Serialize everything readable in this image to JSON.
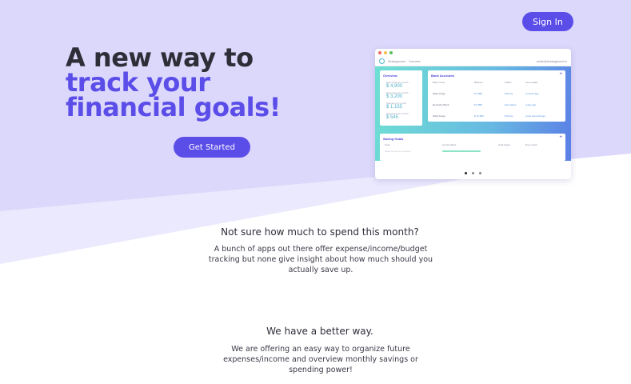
{
  "header": {
    "signin_label": "Sign In"
  },
  "hero": {
    "headline_line1": "A new way to",
    "headline_line2": "track your financial goals!",
    "cta_label": "Get Started"
  },
  "preview": {
    "nav_items": [
      "Strategyboard",
      "Overview"
    ],
    "nav_right": "admin@strategyboard.io",
    "overview": {
      "title": "Overview",
      "items": [
        {
          "label": "Expenses per month",
          "value": "$ 4,900"
        },
        {
          "label": "Expenses per month",
          "value": "$ 3,200"
        },
        {
          "label": "Savings per month",
          "value": "$ 1,155"
        },
        {
          "label": "Expenses per month",
          "value": "$ 545"
        }
      ]
    },
    "bank": {
      "title": "Bank Accounts",
      "plus": "+",
      "headers": [
        "Bank name",
        "Balance",
        "Status",
        "Last update"
      ],
      "rows": [
        [
          "Wells Fargo",
          "$ 4,850",
          "Primary",
          "a month ago"
        ],
        [
          "Deutsche Bank",
          "$ 4,850",
          "Secondary",
          "a day ago"
        ],
        [
          "Wells Fargo",
          "$ 12,980",
          "Primary",
          "a few seconds ago"
        ]
      ]
    },
    "saving": {
      "title": "Saving Goals",
      "plus": "+",
      "headers": [
        "Goal",
        "Accumulated",
        "Goal target",
        "Due month"
      ],
      "row": [
        "Save money for a house",
        "",
        "",
        ""
      ]
    }
  },
  "section1": {
    "title": "Not sure how much to spend this month?",
    "text": "A bunch of apps out there offer expense/income/budget tracking but none give insight about how much should you actually save up."
  },
  "section2": {
    "title": "We have a better way.",
    "text": "We are offering an easy way to organize future expenses/income and overview monthly savings or spending power!"
  },
  "colors": {
    "brand": "#5b4de8",
    "hero_bg": "#ddd9fb",
    "hero_band": "#ebe9fd",
    "teal": "#6ee0d3"
  }
}
